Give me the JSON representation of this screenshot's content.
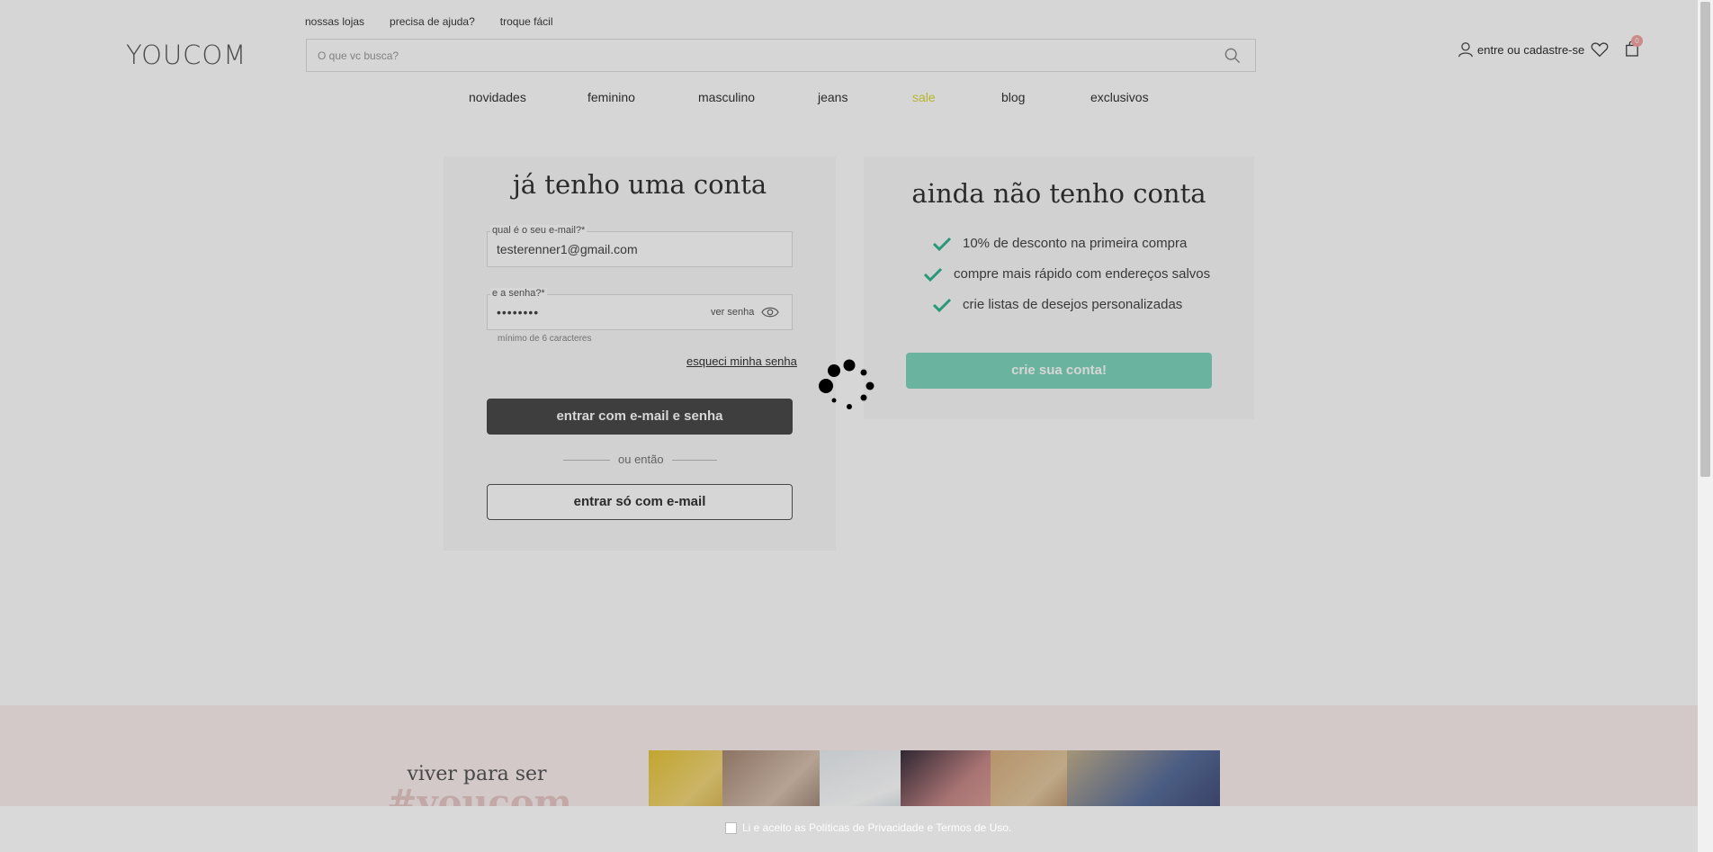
{
  "header": {
    "logo": "YOUCOM",
    "top_links": [
      "nossas lojas",
      "precisa de ajuda?",
      "troque fácil"
    ],
    "search_placeholder": "O que vc busca?",
    "account_label": "entre ou cadastre-se",
    "cart_count": "0",
    "nav": [
      "novidades",
      "feminino",
      "masculino",
      "jeans",
      "sale",
      "blog",
      "exclusivos"
    ],
    "sale_color": "#f3f39a"
  },
  "login": {
    "title": "já tenho uma conta",
    "email_label": "qual é o seu e-mail?*",
    "email_value": "testerenner1@gmail.com",
    "password_label": "e a senha?*",
    "password_value": "••••••••",
    "show_password": "ver senha",
    "password_hint": "mínimo de 6 caracteres",
    "forgot": "esqueci minha senha",
    "submit": "entrar com e-mail e senha",
    "or": "ou então",
    "email_only": "entrar só com e-mail"
  },
  "register": {
    "title": "ainda não tenho conta",
    "benefits": [
      "10% de desconto na primeira compra",
      "compre mais rápido com endereços salvos",
      "crie listas de desejos personalizadas"
    ],
    "button": "crie sua conta!",
    "accent": "#7fd6bd"
  },
  "footer_band": {
    "line1": "viver para ser",
    "line2": "#youcom"
  },
  "consent": {
    "text": "Li e aceito as Políticas de Privacidade e Termos de Uso."
  }
}
